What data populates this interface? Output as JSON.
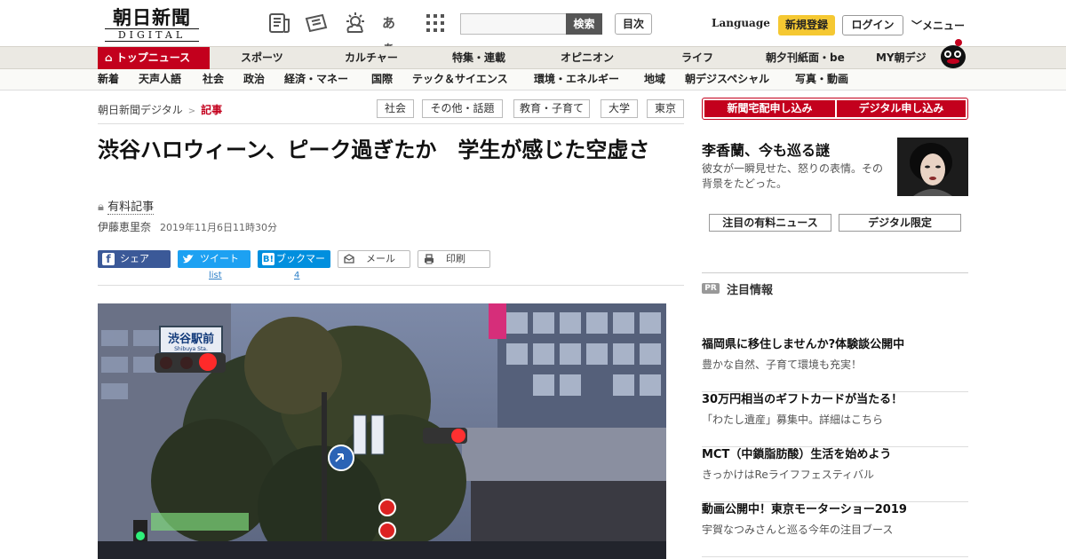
{
  "header": {
    "logo_main": "朝日新聞",
    "logo_sub": "DIGITAL",
    "font_icon_label": "あぁ",
    "search": {
      "placeholder": "",
      "button": "検索"
    },
    "toc_button": "目次",
    "language": "Language",
    "register": "新規登録",
    "login": "ログイン",
    "menu": "メニュー"
  },
  "nav_primary": {
    "active": "トップニュース",
    "items": [
      "スポーツ",
      "カルチャー",
      "特集・連載",
      "オピニオン",
      "ライフ",
      "朝夕刊紙面・be",
      "MY朝デジ"
    ]
  },
  "nav_secondary": {
    "items": [
      "新着",
      "天声人語",
      "社会",
      "政治",
      "経済・マネー",
      "国際",
      "テック＆サイエンス",
      "環境・エネルギー",
      "地域",
      "朝デジスペシャル",
      "写真・動画"
    ]
  },
  "breadcrumb": {
    "home": "朝日新聞デジタル",
    "sep": ">",
    "current": "記事"
  },
  "tags": [
    "社会",
    "その他・話題",
    "教育・子育て",
    "大学",
    "東京"
  ],
  "article": {
    "title": "渋谷ハロウィーン、ピーク過ぎたか　学生が感じた空虚さ",
    "paid_label": "有料記事",
    "author": "伊藤恵里奈",
    "date": "2019年11月6日11時30分",
    "share": {
      "facebook": "シェア",
      "twitter": "ツイート",
      "hatena": "ブックマーク",
      "mail": "メール",
      "print": "印刷",
      "twitter_count": "list",
      "hatena_count": "4"
    },
    "photo_signs": {
      "station_sign_jp": "渋谷駅前",
      "station_sign_en": "Shibuya Sta."
    }
  },
  "sidebar": {
    "subscribe_paper": "新聞宅配申し込み",
    "subscribe_digital": "デジタル申し込み",
    "promo": {
      "title": "李香蘭、今も巡る謎",
      "text": "彼女が一瞬見せた、怒りの表情。その背景をたどった。"
    },
    "box_paid_news": "注目の有料ニュース",
    "box_digital_only": "デジタル限定",
    "pr_badge": "PR",
    "pr_heading": "注目情報",
    "pr_items": [
      {
        "headline": "福岡県に移住しませんか?体験談公開中",
        "sub": "豊かな自然、子育て環境も充実！"
      },
      {
        "headline": "30万円相当のギフトカードが当たる！",
        "sub": "「わたし遺産」募集中。詳細はこちら"
      },
      {
        "headline": "MCT（中鎖脂肪酸）生活を始めよう",
        "sub": "きっかけはReライフフェスティバル"
      },
      {
        "headline": "動画公開中！東京モーターショー2019",
        "sub": "宇賀なつみさんと巡る今年の注目ブース"
      }
    ]
  },
  "colors": {
    "brand_red": "#c3001d",
    "register_yellow": "#f5c832",
    "facebook": "#3b5998",
    "twitter": "#1da1f2",
    "hatena": "#008fde"
  }
}
